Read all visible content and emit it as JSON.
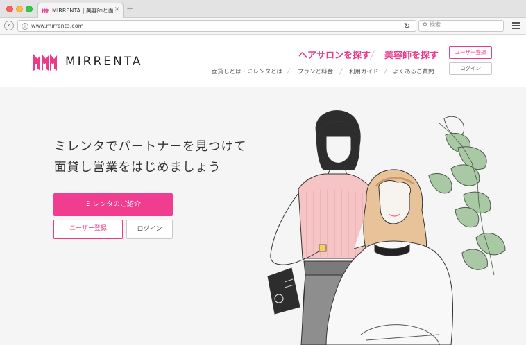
{
  "browser": {
    "tab_title": "MIRRENTA | 美容師と面貸し...",
    "tab_close": "×",
    "new_tab": "+",
    "url": "www.mirrenta.com",
    "search_placeholder": "検索",
    "icons": [
      "back-icon",
      "info-icon",
      "reload-icon",
      "search-icon",
      "menu-icon"
    ]
  },
  "header": {
    "logo_text": "MIRRENTA",
    "brand_color": "#ea3a8a",
    "primary_links": [
      "ヘアサロンを探す",
      "美容師を探す"
    ],
    "secondary_links": [
      "面貸しとは・ミレンタとは",
      "プランと料金",
      "利用ガイド",
      "よくあるご質問"
    ],
    "register_label": "ユーザー登録",
    "login_label": "ログイン"
  },
  "hero": {
    "headline_line1": "ミレンタでパートナーを見つけて",
    "headline_line2": "面貸し営業をはじめましょう",
    "cta_label": "ミレンタのご紹介",
    "register_label": "ユーザー登録",
    "login_label": "ログイン",
    "cta_color": "#f03d8f"
  }
}
